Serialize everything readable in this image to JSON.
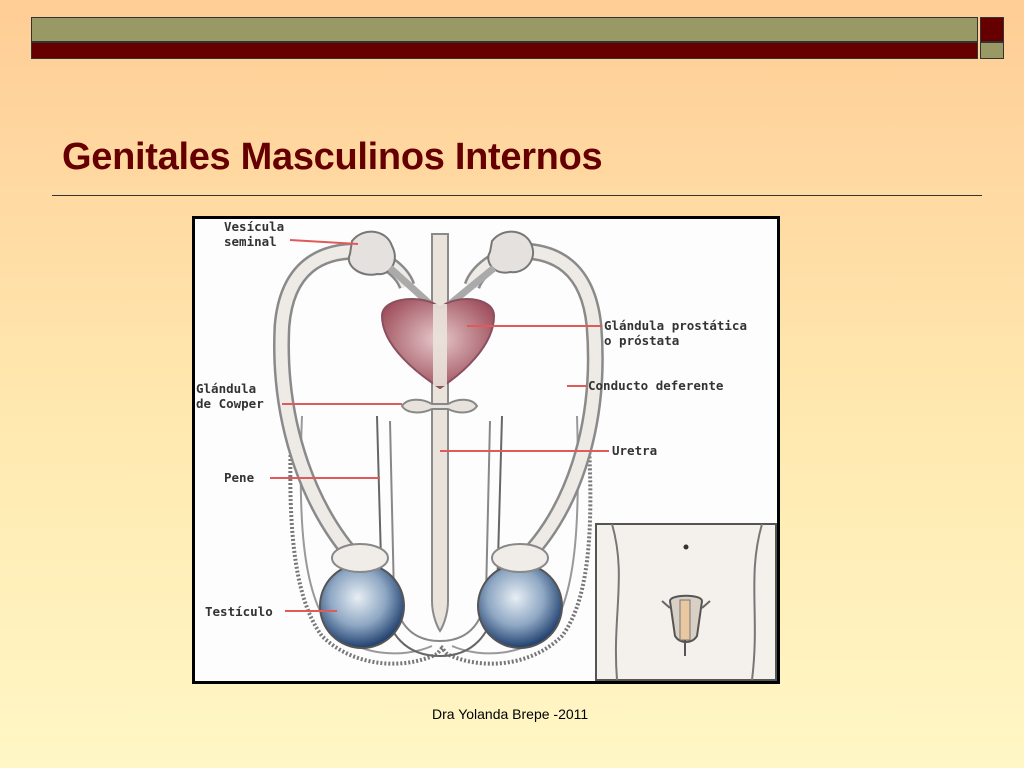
{
  "slide": {
    "title": "Genitales Masculinos Internos",
    "footer": "Dra Yolanda Brepe -2011"
  },
  "diagram": {
    "labels": {
      "vesicula_1": "Vesícula",
      "vesicula_2": "seminal",
      "prostata_1": "Glándula prostática",
      "prostata_2": "o próstata",
      "cowper_1": "Glándula",
      "cowper_2": "de Cowper",
      "conducto": "Conducto deferente",
      "uretra": "Uretra",
      "pene": "Pene",
      "testiculo": "Testículo"
    }
  },
  "colors": {
    "accent": "#660000",
    "olive": "#999966",
    "label_line": "#e05a5a"
  }
}
